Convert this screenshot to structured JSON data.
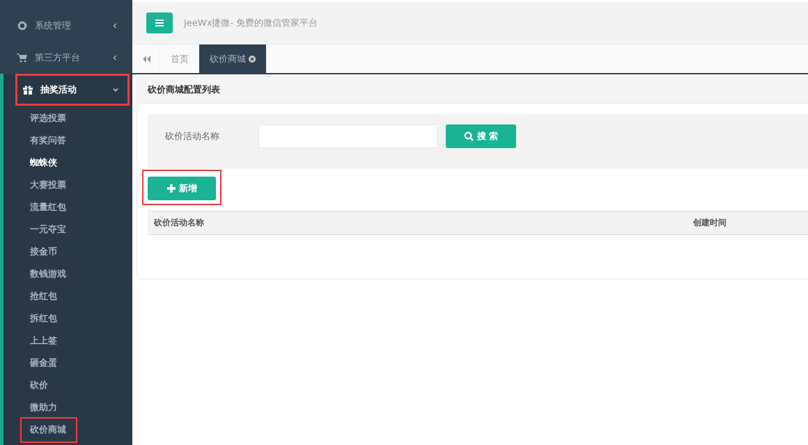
{
  "sidebar": {
    "items": [
      {
        "label": "系统管理",
        "expanded": false
      },
      {
        "label": "第三方平台",
        "expanded": false
      },
      {
        "label": "抽奖活动",
        "expanded": true,
        "highlighted": true,
        "children": [
          {
            "label": "评选投票",
            "selected": false,
            "highlighted": false
          },
          {
            "label": "有奖问答",
            "selected": false,
            "highlighted": false
          },
          {
            "label": "蜘蛛侠",
            "selected": true,
            "highlighted": false
          },
          {
            "label": "大赛投票",
            "selected": false,
            "highlighted": false
          },
          {
            "label": "流量红包",
            "selected": false,
            "highlighted": false
          },
          {
            "label": "一元夺宝",
            "selected": false,
            "highlighted": false
          },
          {
            "label": "接金币",
            "selected": false,
            "highlighted": false
          },
          {
            "label": "数钱游戏",
            "selected": false,
            "highlighted": false
          },
          {
            "label": "抢红包",
            "selected": false,
            "highlighted": false
          },
          {
            "label": "拆红包",
            "selected": false,
            "highlighted": false
          },
          {
            "label": "上上签",
            "selected": false,
            "highlighted": false
          },
          {
            "label": "砸金蛋",
            "selected": false,
            "highlighted": false
          },
          {
            "label": "砍价",
            "selected": false,
            "highlighted": false
          },
          {
            "label": "微助力",
            "selected": false,
            "highlighted": false
          },
          {
            "label": "砍价商城",
            "selected": false,
            "highlighted": true
          }
        ]
      }
    ]
  },
  "header": {
    "title": "JeeWx捷微- 免费的微信管家平台"
  },
  "tabs": [
    {
      "label": "首页",
      "selected": false,
      "closable": false
    },
    {
      "label": "砍价商城",
      "selected": true,
      "closable": true
    }
  ],
  "panel": {
    "title": "砍价商城配置列表",
    "search": {
      "label": "砍价活动名称",
      "button": "搜 索"
    },
    "add_button": {
      "label": "新增",
      "highlighted": true
    },
    "table": {
      "columns": [
        "砍价活动名称",
        "创建时间"
      ]
    }
  }
}
